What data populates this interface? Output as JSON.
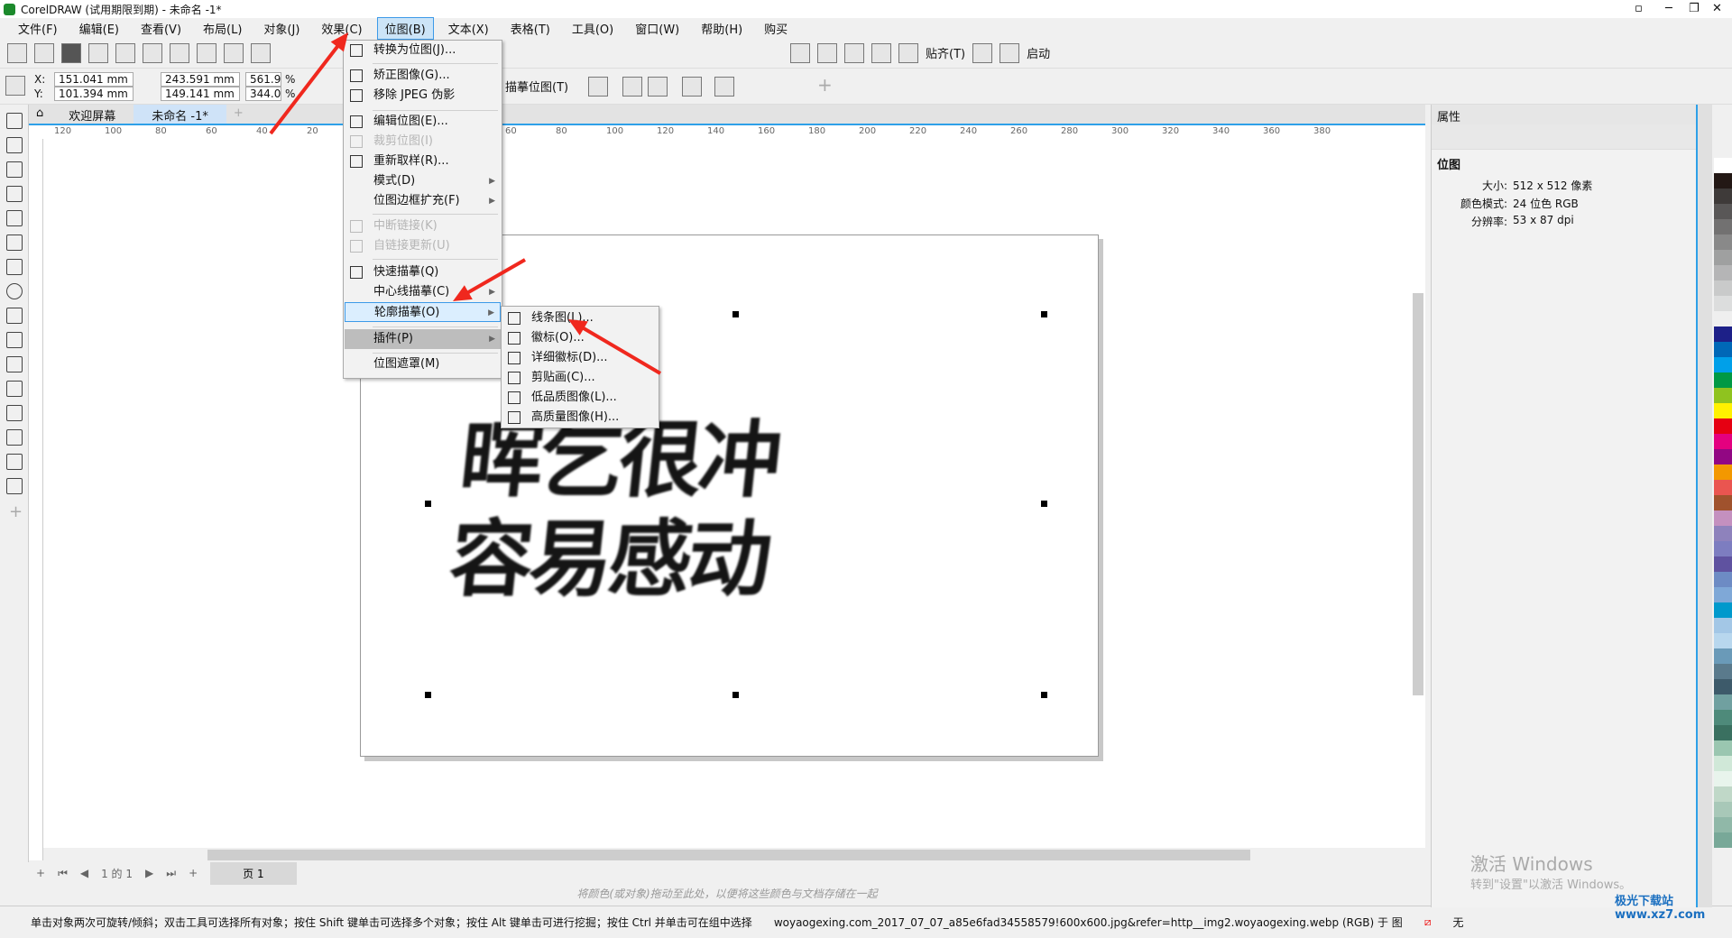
{
  "title": "CorelDRAW (试用期限到期) - 未命名 -1*",
  "menubar": [
    "文件(F)",
    "编辑(E)",
    "查看(V)",
    "布局(L)",
    "对象(J)",
    "效果(C)",
    "位图(B)",
    "文本(X)",
    "表格(T)",
    "工具(O)",
    "窗口(W)",
    "帮助(H)",
    "购买"
  ],
  "toolbar": {
    "snap_label": "贴齐(T)",
    "launch_label": "启动",
    "trace_label": "描摹位图(T)"
  },
  "propbar": {
    "x_label": "X:",
    "y_label": "Y:",
    "x": "151.041 mm",
    "y": "101.394 mm",
    "w": "243.591 mm",
    "h": "149.141 mm",
    "sx": "561.9",
    "sy": "344.0",
    "pct": "%"
  },
  "tabs": [
    "欢迎屏幕",
    "未命名 -1*"
  ],
  "ruler_ticks": [
    "120",
    "100",
    "80",
    "60",
    "40",
    "20",
    "60",
    "80",
    "100",
    "120",
    "140",
    "160",
    "180",
    "200",
    "220",
    "240",
    "260",
    "280",
    "300",
    "320",
    "340",
    "360",
    "380"
  ],
  "artwork": [
    "晖乞很冲",
    "容易感动"
  ],
  "bitmap_menu": [
    {
      "label": "转换为位图(J)...",
      "state": "normal"
    },
    {
      "label": "矫正图像(G)...",
      "state": "normal"
    },
    {
      "label": "移除 JPEG 伪影",
      "state": "normal"
    },
    {
      "label": "编辑位图(E)...",
      "state": "normal"
    },
    {
      "label": "裁剪位图(I)",
      "state": "disabled"
    },
    {
      "label": "重新取样(R)...",
      "state": "normal"
    },
    {
      "label": "模式(D)",
      "state": "submenu"
    },
    {
      "label": "位图边框扩充(F)",
      "state": "submenu"
    },
    {
      "label": "中断链接(K)",
      "state": "disabled"
    },
    {
      "label": "自链接更新(U)",
      "state": "disabled"
    },
    {
      "label": "快速描摹(Q)",
      "state": "normal"
    },
    {
      "label": "中心线描摹(C)",
      "state": "submenu"
    },
    {
      "label": "轮廓描摹(O)",
      "state": "highlighted"
    },
    {
      "label": "插件(P)",
      "state": "submenu"
    },
    {
      "label": "位图遮罩(M)",
      "state": "normal"
    }
  ],
  "outline_submenu": [
    "线条图(L)...",
    "徽标(O)...",
    "详细徽标(D)...",
    "剪贴画(C)...",
    "低品质图像(L)...",
    "高质量图像(H)..."
  ],
  "pagenav": {
    "count": "1 的 1",
    "page": "页 1"
  },
  "palette_hint": "将颜色(或对象)拖动至此处，以便将这些颜色与文档存储在一起",
  "status": {
    "hint": "单击对象两次可旋转/倾斜；双击工具可选择所有对象；按住 Shift 键单击可选择多个对象；按住 Alt 键单击可进行挖掘；按住 Ctrl 并单击可在组中选择",
    "file": "woyaogexing.com_2017_07_07_a85e6fad34558579!600x600.jpg&refer=http__img2.woyaogexing.webp (RGB) 于 图",
    "fill": "无"
  },
  "docker": {
    "title": "属性",
    "section": "位图",
    "rows": [
      {
        "k": "大小:",
        "v": "512 x 512 像素"
      },
      {
        "k": "颜色模式:",
        "v": "24 位色 RGB"
      },
      {
        "k": "分辨率:",
        "v": "53 x 87 dpi"
      }
    ]
  },
  "watermark": {
    "line1": "激活 Windows",
    "line2": "转到\"设置\"以激活 Windows。",
    "site": "极光下载站 www.xz7.com"
  },
  "palette_colors": [
    "#ffffff",
    "#231815",
    "#3e3a39",
    "#595757",
    "#727171",
    "#898989",
    "#9fa0a0",
    "#b5b5b6",
    "#c9caca",
    "#dcdddd",
    "#efefef",
    "#1d2088",
    "#0068b7",
    "#00a0e9",
    "#009944",
    "#8fc31f",
    "#fff100",
    "#e60012",
    "#e4007f",
    "#920783",
    "#f39800",
    "#ea5550",
    "#a0522d",
    "#c490bf",
    "#8e82bc",
    "#7d7dc0",
    "#5f52a0",
    "#6d8bc4",
    "#7fa8d7",
    "#0099cc",
    "#a3c7e6",
    "#b8d7ee",
    "#6a9ab8",
    "#5a7a8c",
    "#3d5a6a",
    "#70a0a0",
    "#4e8a7a",
    "#3a7060",
    "#9ac6b0",
    "#d0e8d8",
    "#e8f4ec",
    "#c0d8c8",
    "#a8c8b8",
    "#90b8a8",
    "#78a898"
  ],
  "accent": "#2ea0e8",
  "arrow_color": "#f0281e"
}
